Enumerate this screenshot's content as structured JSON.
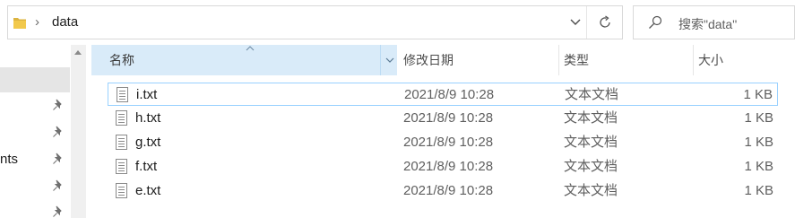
{
  "address": {
    "crumb_sep": "›",
    "path": "data"
  },
  "search": {
    "placeholder": "搜索\"data\""
  },
  "nav": {
    "partial_label": "nts"
  },
  "columns": {
    "name": "名称",
    "date": "修改日期",
    "type": "类型",
    "size": "大小"
  },
  "files": [
    {
      "name": "i.txt",
      "date": "2021/8/9 10:28",
      "type": "文本文档",
      "size": "1 KB"
    },
    {
      "name": "h.txt",
      "date": "2021/8/9 10:28",
      "type": "文本文档",
      "size": "1 KB"
    },
    {
      "name": "g.txt",
      "date": "2021/8/9 10:28",
      "type": "文本文档",
      "size": "1 KB"
    },
    {
      "name": "f.txt",
      "date": "2021/8/9 10:28",
      "type": "文本文档",
      "size": "1 KB"
    },
    {
      "name": "e.txt",
      "date": "2021/8/9 10:28",
      "type": "文本文档",
      "size": "1 KB"
    }
  ],
  "colors": {
    "header_selected": "#d9ebf9",
    "row_focus_border": "#99d1ff",
    "folder": "#f2c94c"
  },
  "icons": {
    "folder": "folder-icon",
    "search": "search-icon",
    "refresh": "refresh-icon",
    "dropdown": "chevron-down-icon",
    "pin": "pin-icon",
    "file": "text-file-icon"
  }
}
